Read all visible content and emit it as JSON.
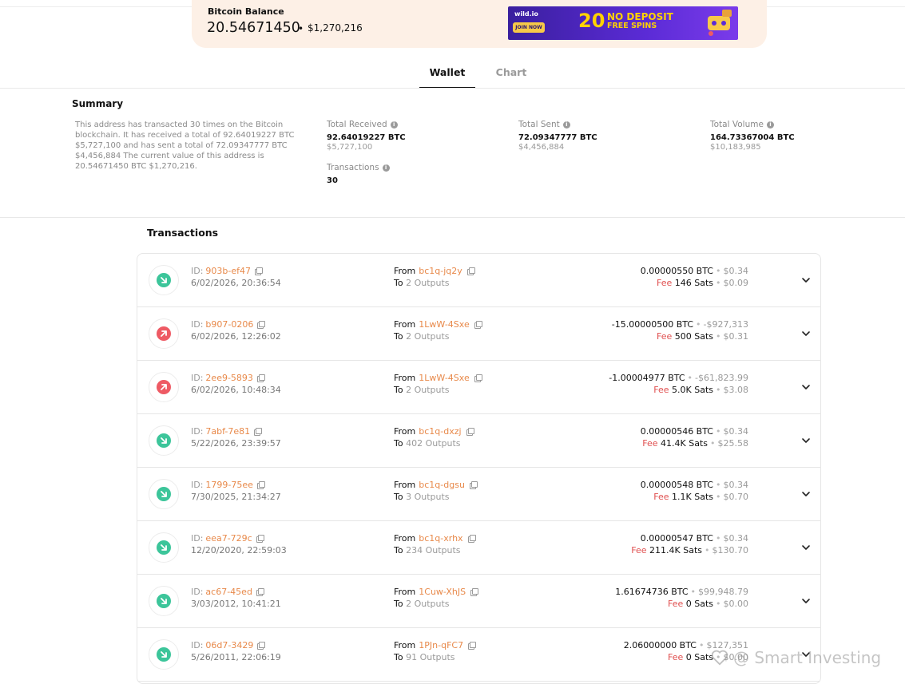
{
  "balance": {
    "label": "Bitcoin Balance",
    "btc": "20.54671450",
    "dot": "•",
    "usd": "$1,270,216"
  },
  "ad": {
    "logo": "wild.io",
    "join": "JOIN NOW",
    "number": "20",
    "line1": "NO DEPOSIT",
    "line2": "FREE SPINS"
  },
  "tabs": [
    {
      "label": "Wallet",
      "active": true
    },
    {
      "label": "Chart",
      "active": false
    }
  ],
  "summary": {
    "title": "Summary",
    "text": "This address has transacted 30 times on the Bitcoin blockchain. It has received a total of 92.64019227 BTC $5,727,100 and has sent a total of 72.09347777 BTC $4,456,884 The current value of this address is 20.54671450 BTC $1,270,216.",
    "total_received": {
      "label": "Total Received",
      "value": "92.64019227 BTC",
      "usd": "$5,727,100"
    },
    "total_sent": {
      "label": "Total Sent",
      "value": "72.09347777 BTC",
      "usd": "$4,456,884"
    },
    "total_volume": {
      "label": "Total Volume",
      "value": "164.73367004 BTC",
      "usd": "$10,183,985"
    },
    "transactions": {
      "label": "Transactions",
      "value": "30"
    }
  },
  "transactions_title": "Transactions",
  "labels": {
    "id": "ID:",
    "from": "From",
    "to": "To",
    "fee": "Fee",
    "sep": "•"
  },
  "transactions": [
    {
      "direction": "in",
      "id": "903b-ef47",
      "date": "6/02/2026, 20:36:54",
      "from": "bc1q-jq2y",
      "to": "2 Outputs",
      "amount": "0.00000550 BTC",
      "amount_usd": "$0.34",
      "fee": "146 Sats",
      "fee_usd": "$0.09"
    },
    {
      "direction": "out",
      "id": "b907-0206",
      "date": "6/02/2026, 12:26:02",
      "from": "1LwW-4Sxe",
      "to": "2 Outputs",
      "amount": "-15.00000500 BTC",
      "amount_usd": "-$927,313",
      "fee": "500 Sats",
      "fee_usd": "$0.31"
    },
    {
      "direction": "out",
      "id": "2ee9-5893",
      "date": "6/02/2026, 10:48:34",
      "from": "1LwW-4Sxe",
      "to": "2 Outputs",
      "amount": "-1.00004977 BTC",
      "amount_usd": "-$61,823.99",
      "fee": "5.0K Sats",
      "fee_usd": "$3.08"
    },
    {
      "direction": "in",
      "id": "7abf-7e81",
      "date": "5/22/2026, 23:39:57",
      "from": "bc1q-dxzj",
      "to": "402 Outputs",
      "amount": "0.00000546 BTC",
      "amount_usd": "$0.34",
      "fee": "41.4K Sats",
      "fee_usd": "$25.58"
    },
    {
      "direction": "in",
      "id": "1799-75ee",
      "date": "7/30/2025, 21:34:27",
      "from": "bc1q-dgsu",
      "to": "3 Outputs",
      "amount": "0.00000548 BTC",
      "amount_usd": "$0.34",
      "fee": "1.1K Sats",
      "fee_usd": "$0.70"
    },
    {
      "direction": "in",
      "id": "eea7-729c",
      "date": "12/20/2020, 22:59:03",
      "from": "bc1q-xrhx",
      "to": "234 Outputs",
      "amount": "0.00000547 BTC",
      "amount_usd": "$0.34",
      "fee": "211.4K Sats",
      "fee_usd": "$130.70"
    },
    {
      "direction": "in",
      "id": "ac67-45ed",
      "date": "3/03/2012, 10:41:21",
      "from": "1Cuw-XhJS",
      "to": "2 Outputs",
      "amount": "1.61674736 BTC",
      "amount_usd": "$99,948.79",
      "fee": "0 Sats",
      "fee_usd": "$0.00"
    },
    {
      "direction": "in",
      "id": "06d7-3429",
      "date": "5/26/2011, 22:06:19",
      "from": "1PJn-qFC7",
      "to": "91 Outputs",
      "amount": "2.06000000 BTC",
      "amount_usd": "$127,351",
      "fee": "0 Sats",
      "fee_usd": "$0.00"
    }
  ],
  "watermark": "@ Smart Investing",
  "colors": {
    "accent": "#e8894a",
    "incoming": "#3cc59a",
    "outgoing": "#ee5a64",
    "fee": "#e05050",
    "card": "#fdf0e6"
  }
}
